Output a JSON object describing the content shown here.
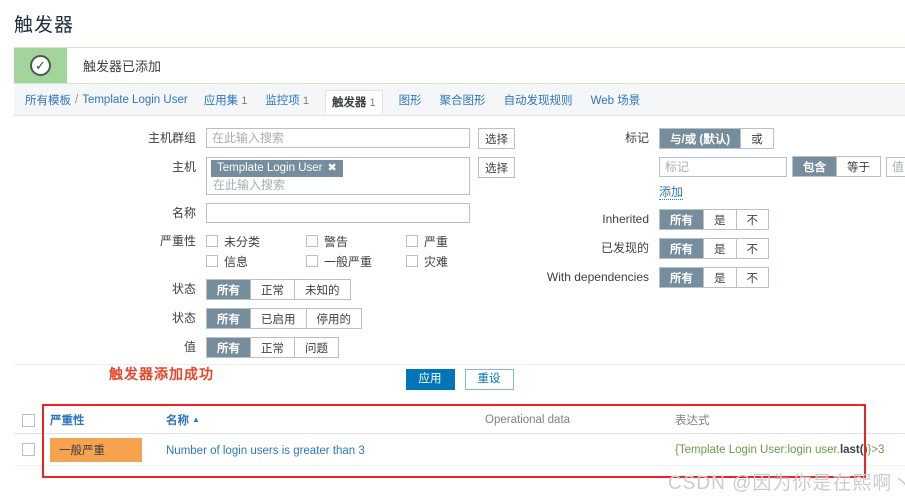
{
  "page": {
    "title": "触发器",
    "watermark": "CSDN @因为你是在熙啊丶"
  },
  "message": {
    "icon": "check-circle-icon",
    "text": "触发器已添加"
  },
  "breadcrumb": {
    "root": "所有模板",
    "separator": "/",
    "current": "Template Login User"
  },
  "tabs": [
    {
      "label": "应用集",
      "count": "1",
      "active": false
    },
    {
      "label": "监控项",
      "count": "1",
      "active": false
    },
    {
      "label": "触发器",
      "count": "1",
      "active": true
    },
    {
      "label": "图形",
      "count": "",
      "active": false
    },
    {
      "label": "聚合图形",
      "count": "",
      "active": false
    },
    {
      "label": "自动发现规则",
      "count": "",
      "active": false
    },
    {
      "label": "Web 场景",
      "count": "",
      "active": false
    }
  ],
  "filter": {
    "host_groups": {
      "label": "主机群组",
      "placeholder": "在此输入搜索",
      "select_button": "选择"
    },
    "hosts": {
      "label": "主机",
      "chip": "Template Login User",
      "chip_remove": "✖",
      "placeholder": "在此输入搜索",
      "select_button": "选择"
    },
    "name": {
      "label": "名称",
      "value": ""
    },
    "severity": {
      "label": "严重性",
      "options": [
        {
          "label": "未分类",
          "checked": false
        },
        {
          "label": "警告",
          "checked": false
        },
        {
          "label": "严重",
          "checked": false
        },
        {
          "label": "信息",
          "checked": false
        },
        {
          "label": "一般严重",
          "checked": false
        },
        {
          "label": "灾难",
          "checked": false
        }
      ]
    },
    "state": {
      "label": "状态",
      "options": [
        "所有",
        "正常",
        "未知的"
      ],
      "selected": "所有"
    },
    "status": {
      "label": "状态",
      "options": [
        "所有",
        "已启用",
        "停用的"
      ],
      "selected": "所有"
    },
    "value": {
      "label": "值",
      "options": [
        "所有",
        "正常",
        "问题"
      ],
      "selected": "所有"
    },
    "tags": {
      "label": "标记",
      "evaltype_options": [
        "与/或 (默认)",
        "或"
      ],
      "evaltype_selected": "与/或 (默认)",
      "tag_placeholder": "标记",
      "operator_options": [
        "包含",
        "等于"
      ],
      "operator_selected": "包含",
      "value_placeholder": "值",
      "add_link": "添加"
    },
    "inherited": {
      "label": "Inherited",
      "options": [
        "所有",
        "是",
        "不"
      ],
      "selected": "所有"
    },
    "discovered": {
      "label": "已发现的",
      "options": [
        "所有",
        "是",
        "不"
      ],
      "selected": "所有"
    },
    "with_dependencies": {
      "label": "With dependencies",
      "options": [
        "所有",
        "是",
        "不"
      ],
      "selected": "所有"
    },
    "apply_button": "应用",
    "reset_button": "重设"
  },
  "success_note": "触发器添加成功",
  "table": {
    "headers": {
      "severity": "严重性",
      "name": "名称",
      "sort_arrow": "▲",
      "operational_data": "Operational data",
      "expression": "表达式"
    },
    "rows": [
      {
        "severity": "一般严重",
        "severity_color": "#f5a34f",
        "name": "Number of login users is greater than 3",
        "operational_data": "",
        "expression_prefix": "{Template Login User:login user.",
        "expression_fn": "last()",
        "expression_suffix": "}>3"
      }
    ]
  }
}
